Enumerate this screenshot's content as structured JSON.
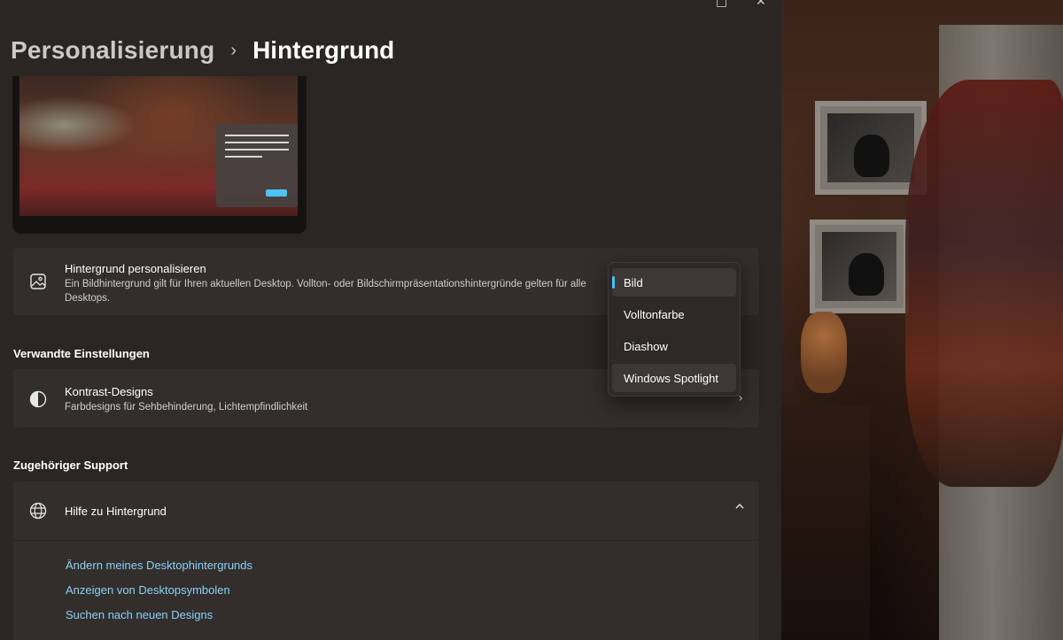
{
  "breadcrumb": {
    "parent": "Personalisierung",
    "separator": "›",
    "current": "Hintergrund"
  },
  "titlebar": {
    "maximize_icon": "□",
    "close_icon": "✕"
  },
  "personalize_card": {
    "title": "Hintergrund personalisieren",
    "description": "Ein Bildhintergrund gilt für Ihren aktuellen Desktop. Vollton- oder Bildschirmpräsentationshintergründe gelten für alle Desktops.",
    "icon": "image-icon"
  },
  "dropdown": {
    "selected": "Bild",
    "options": [
      "Bild",
      "Volltonfarbe",
      "Diashow",
      "Windows Spotlight"
    ],
    "accent_color": "#4cc2ff"
  },
  "related_settings": {
    "heading": "Verwandte Einstellungen",
    "items": [
      {
        "title": "Kontrast-Designs",
        "description": "Farbdesigns für Sehbehinderung, Lichtempfindlichkeit",
        "icon": "contrast-icon"
      }
    ]
  },
  "support": {
    "heading": "Zugehöriger Support",
    "expander_title": "Hilfe zu Hintergrund",
    "icon": "globe-icon",
    "links": [
      "Ändern meines Desktophintergrunds",
      "Anzeigen von Desktopsymbolen",
      "Suchen nach neuen Designs"
    ]
  },
  "colors": {
    "background": "#2a2624",
    "card": "#322e2c",
    "link": "#8bd0f5",
    "accent": "#4cc2ff"
  }
}
